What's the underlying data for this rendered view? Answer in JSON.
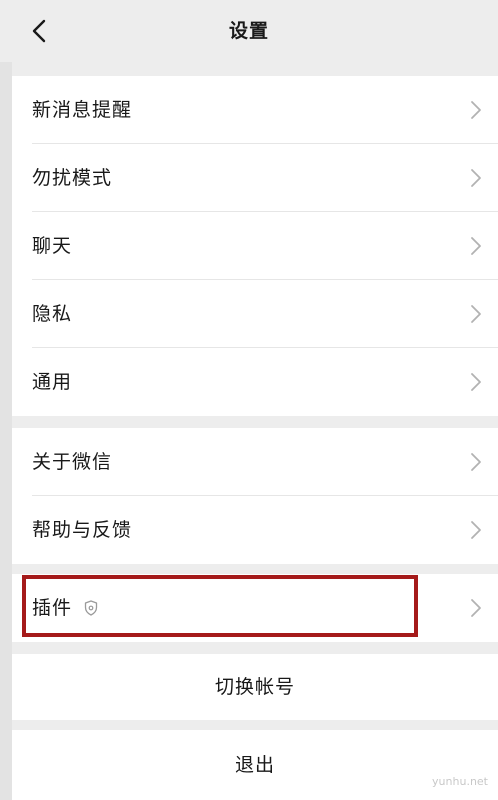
{
  "nav": {
    "title": "设置"
  },
  "settings": {
    "group1": [
      {
        "label": "新消息提醒"
      },
      {
        "label": "勿扰模式"
      },
      {
        "label": "聊天"
      },
      {
        "label": "隐私"
      },
      {
        "label": "通用"
      }
    ],
    "group2": [
      {
        "label": "关于微信"
      },
      {
        "label": "帮助与反馈"
      }
    ],
    "plugins": {
      "label": "插件"
    }
  },
  "actions": {
    "switch_account": "切换帐号",
    "logout": "退出"
  },
  "watermark": "yunhu.net",
  "colors": {
    "background": "#ededed",
    "card": "#ffffff",
    "highlight": "#a51a1a",
    "chevron": "#b2b2b2"
  },
  "icons": {
    "back": "chevron-left-icon",
    "row_arrow": "chevron-right-icon",
    "plugin": "shield-icon"
  }
}
